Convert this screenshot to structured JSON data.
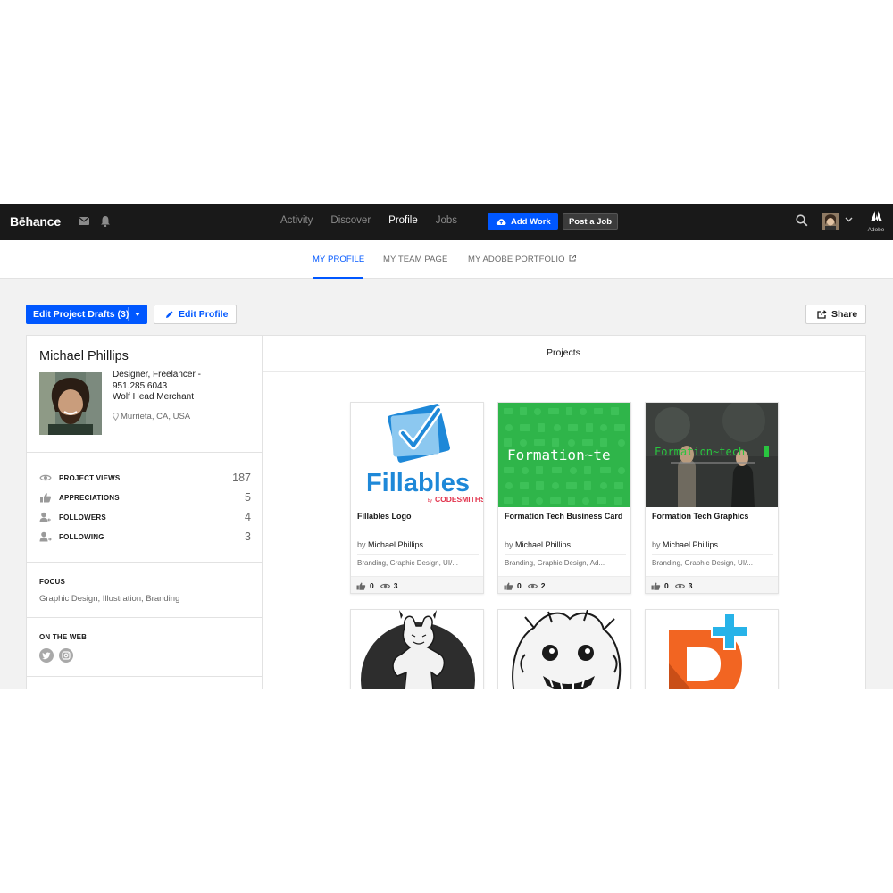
{
  "topnav": {
    "logo": "Bēhance",
    "links": [
      "Activity",
      "Discover",
      "Profile",
      "Jobs"
    ],
    "active_link": "Profile",
    "add_work_label": "Add Work",
    "post_job_label": "Post a Job",
    "adobe_label": "Adobe"
  },
  "subnav": {
    "tabs": [
      "MY PROFILE",
      "MY TEAM PAGE",
      "MY ADOBE PORTFOLIO"
    ],
    "active": "MY PROFILE"
  },
  "actions": {
    "drafts_label": "Edit Project Drafts (3)",
    "edit_profile_label": "Edit Profile",
    "share_label": "Share"
  },
  "profile": {
    "name": "Michael Phillips",
    "meta_lines": [
      "Designer, Freelancer -",
      "951.285.6043",
      "Wolf Head Merchant"
    ],
    "location": "Murrieta, CA, USA",
    "stats": [
      {
        "label": "PROJECT VIEWS",
        "value": "187",
        "icon": "eye-icon"
      },
      {
        "label": "APPRECIATIONS",
        "value": "5",
        "icon": "thumbs-up-icon"
      },
      {
        "label": "FOLLOWERS",
        "value": "4",
        "icon": "follower-icon"
      },
      {
        "label": "FOLLOWING",
        "value": "3",
        "icon": "following-icon"
      }
    ],
    "focus_title": "FOCUS",
    "focus_text": "Graphic Design, Illustration, Branding",
    "web_title": "ON THE WEB",
    "web_links": [
      "twitter-icon",
      "instagram-icon"
    ]
  },
  "projects_tab": "Projects",
  "cards": [
    {
      "title": "Fillables Logo",
      "by": "by",
      "owner": "Michael Phillips",
      "fields": "Branding, Graphic Design, UI/...",
      "likes": "0",
      "views": "3",
      "cover_word": "Fillables",
      "cover_sub": "by",
      "cover_brand": "CODESMITHS"
    },
    {
      "title": "Formation Tech Business Card",
      "by": "by",
      "owner": "Michael Phillips",
      "fields": "Branding, Graphic Design, Ad...",
      "likes": "0",
      "views": "2",
      "cover_word": "Formation~te"
    },
    {
      "title": "Formation Tech Graphics",
      "by": "by",
      "owner": "Michael Phillips",
      "fields": "Branding, Graphic Design, UI/...",
      "likes": "0",
      "views": "3",
      "cover_word": "Formation~tech"
    }
  ],
  "colors": {
    "accent": "#0057ff",
    "nav_bg": "#191919",
    "page_bg": "#f2f2f2",
    "green_cover": "#2fb54a"
  }
}
